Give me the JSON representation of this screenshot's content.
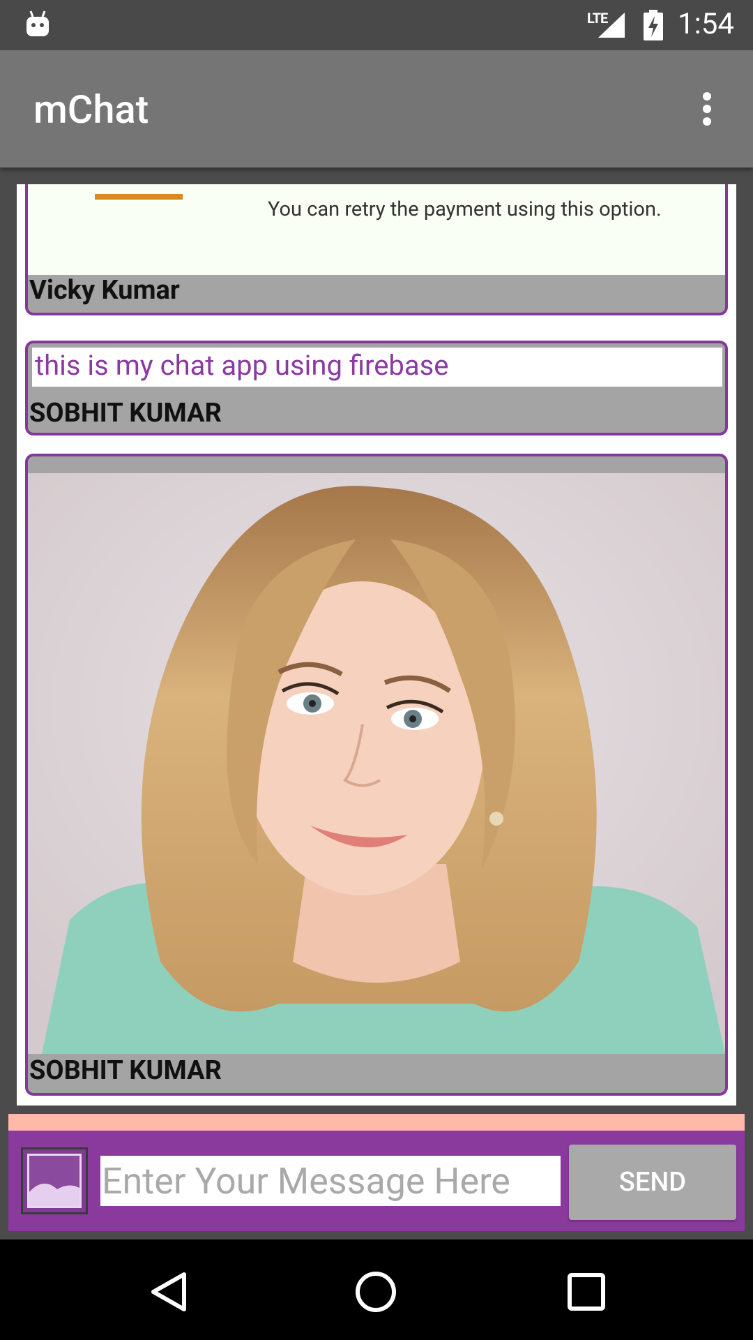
{
  "status_bar": {
    "network": "LTE",
    "time": "1:54",
    "icons": [
      "android-icon",
      "signal-icon",
      "battery-charging-icon"
    ]
  },
  "toolbar": {
    "title": "mChat",
    "menu_icon": "overflow-menu-icon"
  },
  "messages": [
    {
      "type": "image",
      "image_text": "You can retry the payment using this option.",
      "sender": "Vicky Kumar"
    },
    {
      "type": "text",
      "text": "this is my chat app using firebase",
      "sender": "SOBHIT KUMAR"
    },
    {
      "type": "image",
      "image": "portrait-photo",
      "sender": "SOBHIT KUMAR"
    }
  ],
  "composer": {
    "image_button_icon": "image-picker-icon",
    "placeholder": "Enter Your Message Here",
    "value": "",
    "send_label": "SEND"
  },
  "nav_bar": {
    "icons": [
      "back-icon",
      "home-icon",
      "recents-icon"
    ]
  },
  "colors": {
    "accent": "#83399b",
    "toolbar": "#757575",
    "status_bar": "#494949",
    "message_footer": "#a4a4a4",
    "input_bar": "#8a3a9c",
    "strip": "#ffb9a8"
  }
}
